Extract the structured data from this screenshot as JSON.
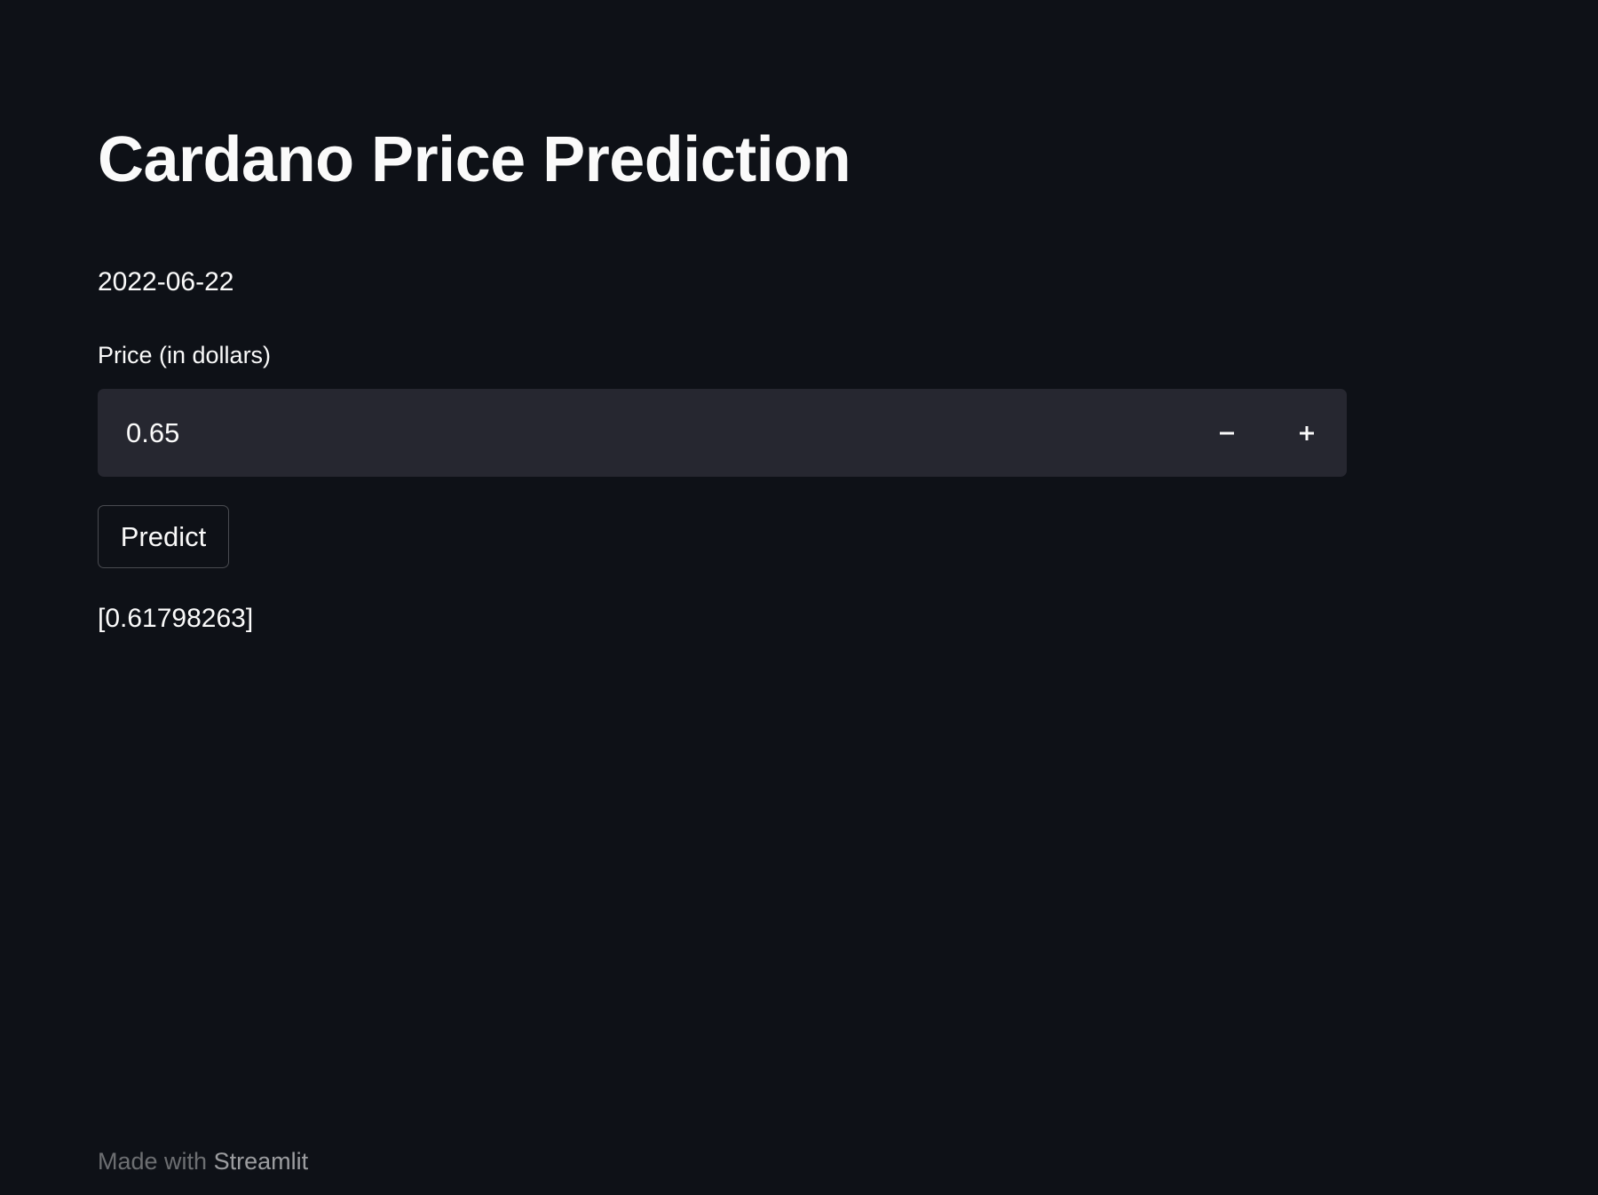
{
  "header": {
    "title": "Cardano Price Prediction"
  },
  "main": {
    "date": "2022-06-22",
    "price_label": "Price (in dollars)",
    "price_value": "0.65",
    "decrement_label": "−",
    "increment_label": "+",
    "predict_label": "Predict",
    "result": "[0.61798263]"
  },
  "footer": {
    "prefix": "Made with ",
    "link": "Streamlit"
  },
  "colors": {
    "background": "#0e1117",
    "input_background": "#262730",
    "text": "#fafafa"
  }
}
